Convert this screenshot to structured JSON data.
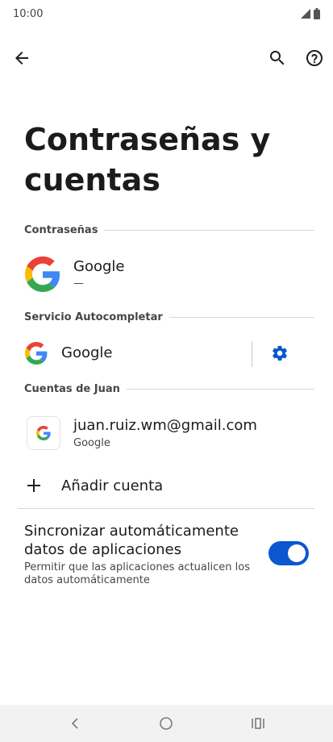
{
  "status": {
    "time": "10:00"
  },
  "header": {
    "title_line1": "Contraseñas y",
    "title_line2": "cuentas"
  },
  "passwords": {
    "section_label": "Contraseñas",
    "provider_name": "Google",
    "provider_detail": "—"
  },
  "autofill": {
    "section_label": "Servicio Autocompletar",
    "service_name": "Google"
  },
  "accounts": {
    "section_label": "Cuentas de Juan",
    "items": [
      {
        "email": "juan.ruiz.wm@gmail.com",
        "type": "Google"
      }
    ],
    "add_label": "Añadir cuenta"
  },
  "sync": {
    "title_line1": "Sincronizar automáticamente",
    "title_line2": "datos de aplicaciones",
    "description_line1": "Permitir que las aplicaciones actualicen los",
    "description_line2": "datos automáticamente",
    "enabled": true
  },
  "colors": {
    "accent": "#0b57d0",
    "google_blue": "#4285F4",
    "google_red": "#EA4335",
    "google_yellow": "#FBBC05",
    "google_green": "#34A853"
  },
  "icons": [
    "back-arrow-icon",
    "search-icon",
    "help-icon",
    "google-logo-icon",
    "gear-icon",
    "plus-icon",
    "nav-back-icon",
    "nav-home-icon",
    "nav-recents-icon"
  ]
}
